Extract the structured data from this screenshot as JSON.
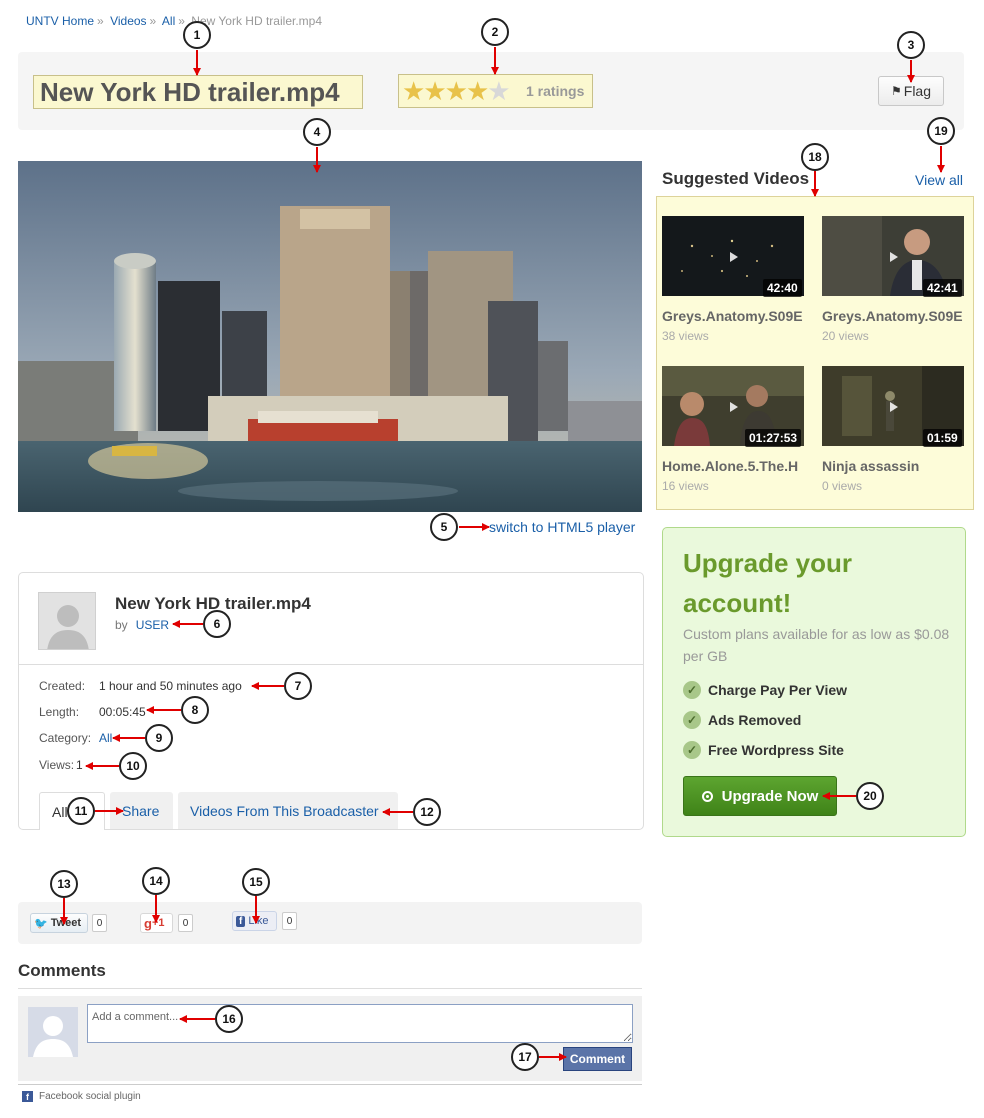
{
  "breadcrumb": {
    "items": [
      "UNTV",
      "Home",
      "Videos",
      "All"
    ],
    "separator": "»",
    "current": "New York HD trailer.mp4"
  },
  "video": {
    "title": "New York HD trailer.mp4",
    "rating_stars": 4,
    "rating_max": 5,
    "ratings_text": "1 ratings",
    "flag_label": "Flag",
    "html5_link": "switch to HTML5 player"
  },
  "info": {
    "name": "New York HD trailer.mp4",
    "by_label": "by",
    "user": "USER",
    "created_label": "Created:",
    "created_value": "1 hour and 50 minutes ago",
    "length_label": "Length:",
    "length_value": "00:05:45",
    "category_label": "Category:",
    "category_value": "All",
    "views_label": "Views:",
    "views_value": "1",
    "tabs": [
      "All",
      "Share",
      "Videos From This Broadcaster"
    ]
  },
  "social": {
    "tweet_label": "Tweet",
    "tweet_count": "0",
    "gplus_label": "+1",
    "gplus_count": "0",
    "fb_label": "Like",
    "fb_count": "0"
  },
  "comments": {
    "title": "Comments",
    "placeholder": "Add a comment...",
    "button": "Comment",
    "plugin_label": "Facebook social plugin"
  },
  "suggested": {
    "title": "Suggested Videos",
    "view_all": "View all",
    "videos": [
      {
        "title": "Greys.Anatomy.S09E",
        "views": "38 views",
        "duration": "42:40"
      },
      {
        "title": "Greys.Anatomy.S09E",
        "views": "20 views",
        "duration": "42:41"
      },
      {
        "title": "Home.Alone.5.The.H",
        "views": "16 views",
        "duration": "01:27:53"
      },
      {
        "title": "Ninja assassin",
        "views": "0 views",
        "duration": "01:59"
      }
    ]
  },
  "upgrade": {
    "title": "Upgrade your account!",
    "subtitle": "Custom plans available for as low as $0.08 per GB",
    "features": [
      "Charge Pay Per View",
      "Ads Removed",
      "Free Wordpress Site"
    ],
    "button": "Upgrade Now"
  },
  "callouts": [
    "1",
    "2",
    "3",
    "4",
    "5",
    "6",
    "7",
    "8",
    "9",
    "10",
    "11",
    "12",
    "13",
    "14",
    "15",
    "16",
    "17",
    "18",
    "19",
    "20"
  ],
  "colors": {
    "link": "#1a5fa8",
    "highlight_fill": "#fbf8d0",
    "upgrade_green": "#6a9a2c",
    "callout_arrow": "#e00000"
  }
}
